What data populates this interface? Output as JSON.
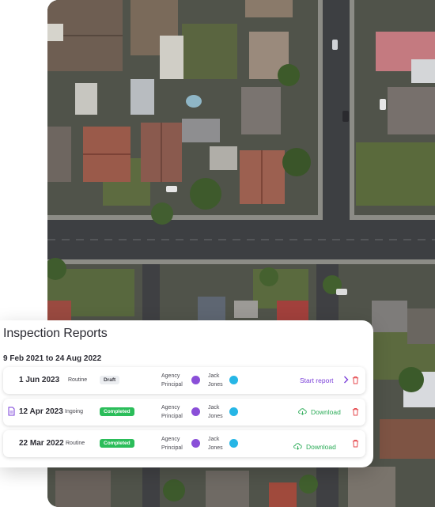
{
  "colors": {
    "accent_purple": "#7a3fd9",
    "completed_green": "#2bbd5a",
    "download_green": "#2bab57",
    "delete_red": "#e5484d",
    "avatar_purple": "#8a4fd8",
    "avatar_cyan": "#26b6e6"
  },
  "card": {
    "title": "Inspection Reports",
    "date_range": "9 Feb 2021 to 24 Aug 2022"
  },
  "reports": [
    {
      "date": "1 Jun 2023",
      "type": "Routine",
      "status": "Draft",
      "role_line1": "Agency",
      "role_line2": "Principal",
      "name_line1": "Jack",
      "name_line2": "Jones",
      "action": "Start report",
      "action_icon": "chevron-right-icon",
      "has_doc_icon": false
    },
    {
      "date": "12 Apr 2023",
      "type": "Ingoing",
      "status": "Completed",
      "role_line1": "Agency",
      "role_line2": "Principal",
      "name_line1": "Jack",
      "name_line2": "Jones",
      "action": "Download",
      "action_icon": "cloud-download-icon",
      "has_doc_icon": true
    },
    {
      "date": "22 Mar 2022",
      "type": "Routine",
      "status": "Completed",
      "role_line1": "Agency",
      "role_line2": "Principal",
      "name_line1": "Jack",
      "name_line2": "Jones",
      "action": "Download",
      "action_icon": "cloud-download-icon",
      "has_doc_icon": false
    }
  ]
}
